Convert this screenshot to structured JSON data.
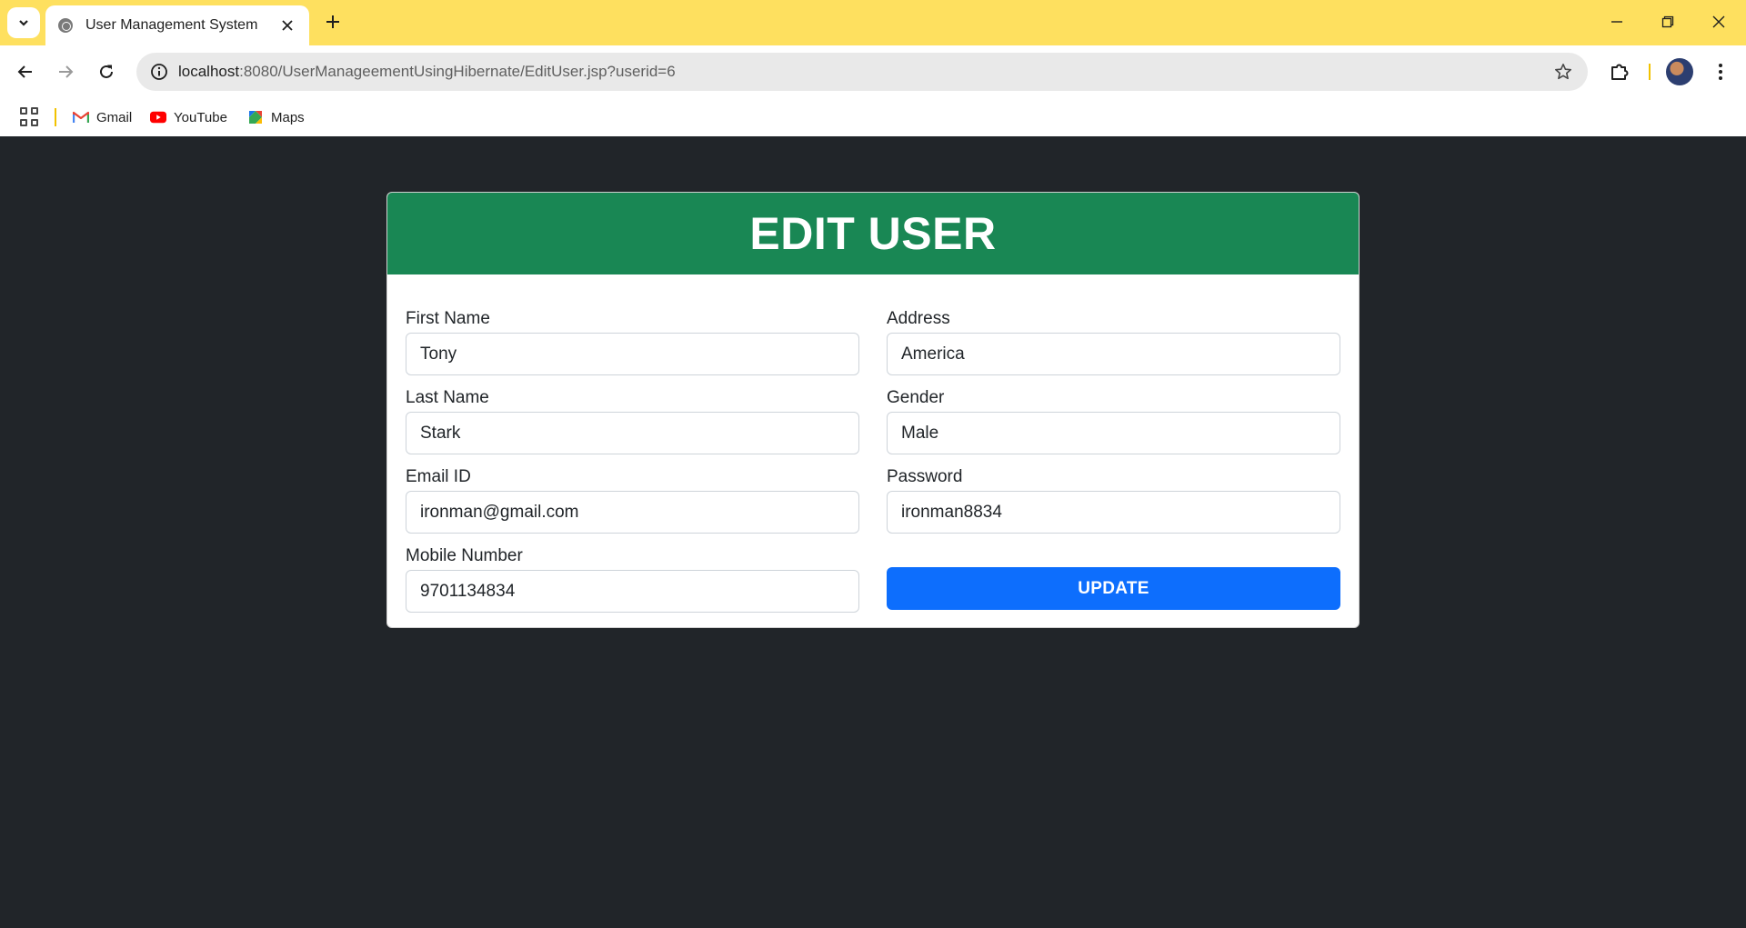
{
  "browser": {
    "tab_title": "User Management System",
    "url_host": "localhost",
    "url_path": ":8080/UserManageementUsingHibernate/EditUser.jsp?userid=6",
    "bookmarks": [
      {
        "label": "Gmail",
        "icon": "gmail-icon"
      },
      {
        "label": "YouTube",
        "icon": "youtube-icon"
      },
      {
        "label": "Maps",
        "icon": "maps-icon"
      }
    ],
    "colors": {
      "tabbar": "#fee05f",
      "omnibox": "#e9e9e9"
    }
  },
  "form": {
    "title": "EDIT USER",
    "fields": {
      "first_name": {
        "label": "First Name",
        "value": "Tony"
      },
      "last_name": {
        "label": "Last Name",
        "value": "Stark"
      },
      "email": {
        "label": "Email ID",
        "value": "ironman@gmail.com"
      },
      "mobile": {
        "label": "Mobile Number",
        "value": "9701134834"
      },
      "address": {
        "label": "Address",
        "value": "America"
      },
      "gender": {
        "label": "Gender",
        "value": "Male"
      },
      "password": {
        "label": "Password",
        "value": "ironman8834"
      }
    },
    "submit_label": "UPDATE",
    "colors": {
      "header": "#198754",
      "button": "#0d6efd",
      "background": "#212529"
    }
  }
}
